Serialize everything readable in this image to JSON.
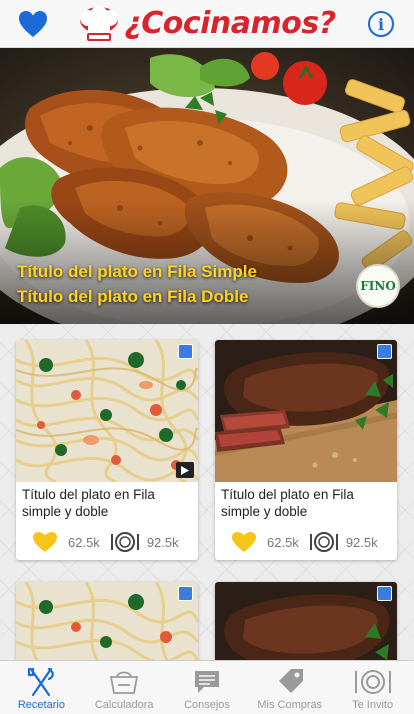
{
  "header": {
    "app_title": "¿Cocinamos?",
    "favorites_icon": "heart-icon",
    "info_icon": "info-icon",
    "info_glyph": "i",
    "accent_color": "#d9232d",
    "link_color": "#1a6ad8"
  },
  "hero": {
    "title_single": "Título del plato en Fila Simple",
    "title_double": "Título del plato en Fila Doble",
    "badge": "FINO",
    "title_color": "#ffd21f"
  },
  "cards": [
    {
      "title": "Título del plato en Fila simple y doble",
      "likes": "62.5k",
      "views": "92.5k",
      "image": "spaghetti",
      "has_video": true
    },
    {
      "title": "Título del plato en Fila simple y doble",
      "likes": "62.5k",
      "views": "92.5k",
      "image": "steak",
      "has_video": false
    },
    {
      "image": "spaghetti"
    },
    {
      "image": "steak"
    }
  ],
  "tabbar": {
    "items": [
      {
        "label": "Recetario",
        "icon": "fork-knife-icon",
        "active": true
      },
      {
        "label": "Calculadora",
        "icon": "scale-icon",
        "active": false
      },
      {
        "label": "Consejos",
        "icon": "chat-icon",
        "active": false
      },
      {
        "label": "Mis Compras",
        "icon": "tag-icon",
        "active": false
      },
      {
        "label": "Te Invito",
        "icon": "plate-icon",
        "active": false
      }
    ]
  }
}
